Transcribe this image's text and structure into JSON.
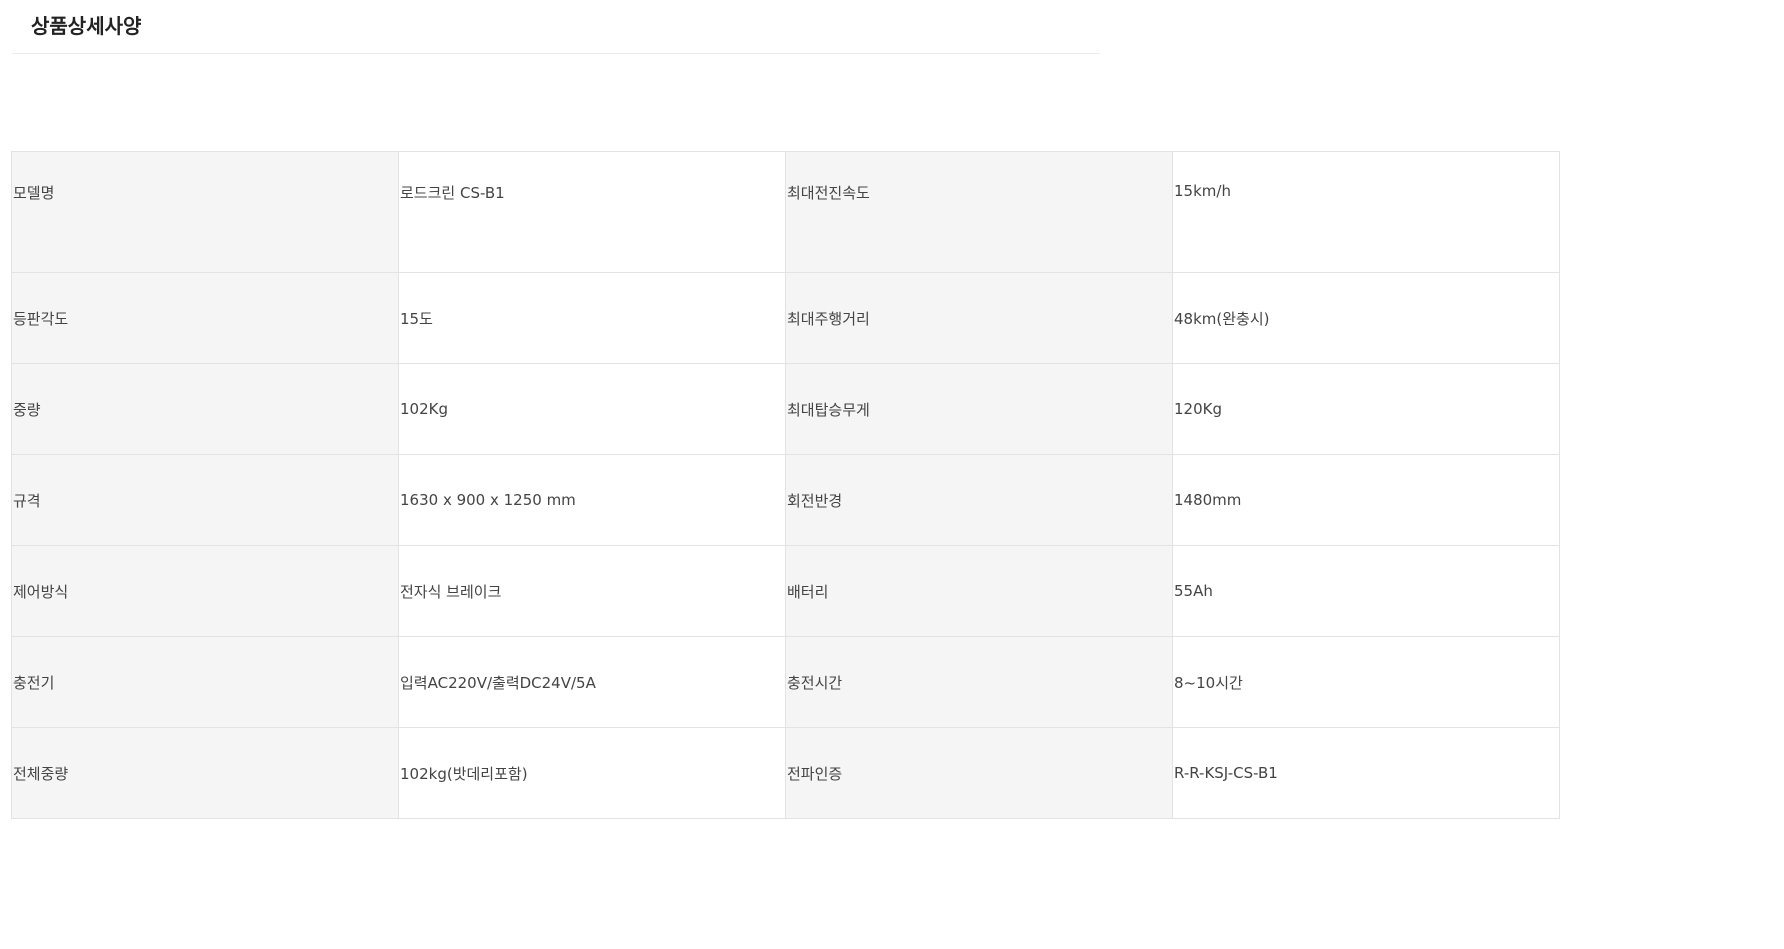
{
  "header": {
    "title": "상품상세사양"
  },
  "specs": {
    "rows": [
      [
        {
          "label": "모델명",
          "value": "로드크린 CS-B1"
        },
        {
          "label": "최대전진속도",
          "value": "15km/h"
        }
      ],
      [
        {
          "label": "등판각도",
          "value": "15도"
        },
        {
          "label": "최대주행거리",
          "value": "48km(완충시)"
        }
      ],
      [
        {
          "label": "중량",
          "value": "102Kg"
        },
        {
          "label": "최대탑승무게",
          "value": "120Kg"
        }
      ],
      [
        {
          "label": "규격",
          "value": "1630 x 900 x 1250 mm"
        },
        {
          "label": "회전반경",
          "value": "1480mm"
        }
      ],
      [
        {
          "label": "제어방식",
          "value": "전자식 브레이크"
        },
        {
          "label": "배터리",
          "value": "55Ah"
        }
      ],
      [
        {
          "label": "충전기",
          "value": "입력AC220V/출력DC24V/5A"
        },
        {
          "label": "충전시간",
          "value": "8~10시간"
        }
      ],
      [
        {
          "label": "전체중량",
          "value": "102kg(밧데리포함)"
        },
        {
          "label": "전파인증",
          "value": "R-R-KSJ-CS-B1"
        }
      ]
    ]
  }
}
